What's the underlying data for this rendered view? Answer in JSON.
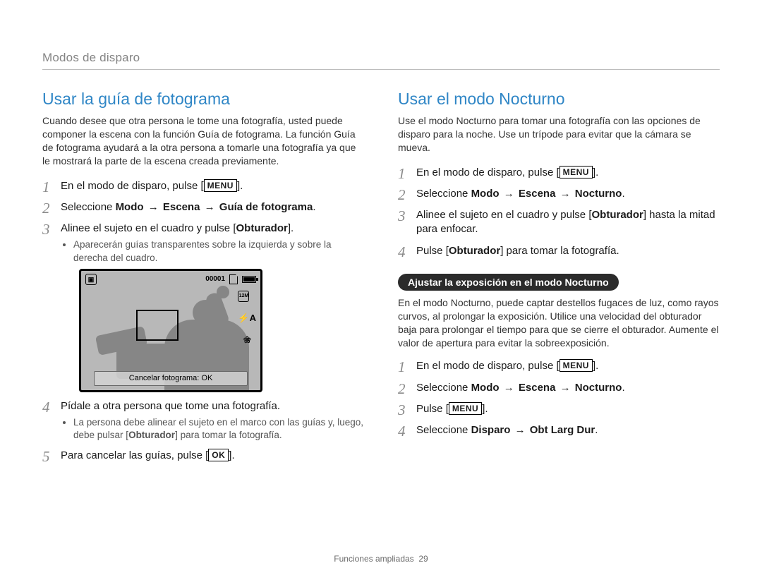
{
  "breadcrumb": "Modos de disparo",
  "footer": {
    "section": "Funciones ampliadas",
    "page": "29"
  },
  "buttons": {
    "menu": "MENU",
    "ok": "OK"
  },
  "left": {
    "title": "Usar la guía de fotograma",
    "intro": "Cuando desee que otra persona le tome una fotografía, usted puede componer la escena con la función Guía de fotograma. La función Guía de fotograma ayudará a la otra persona a tomarle una fotografía ya que le mostrará la parte de la escena creada previamente.",
    "step1_pre": "En el modo de disparo, pulse [",
    "step1_post": "].",
    "step2_pre": "Seleccione ",
    "step2_b1": "Modo",
    "step2_b2": "Escena",
    "step2_b3": "Guía de fotograma",
    "step2_post": ".",
    "step3_pre": "Alinee el sujeto en el cuadro y pulse [",
    "step3_b": "Obturador",
    "step3_post": "].",
    "step3_sub": "Aparecerán guías transparentes sobre la izquierda y sobre la derecha del cuadro.",
    "lcd": {
      "counter": "00001",
      "footer": "Cancelar fotograma: OK",
      "icon_scene": "scene-icon",
      "icon_card": "card-icon",
      "icon_battery": "battery-icon",
      "icon_size": "size-icon",
      "icon_flash": "flash-auto-icon",
      "icon_macro": "macro-icon",
      "flash_label": "⚡A",
      "size_label": "12M",
      "macro_label": "❀"
    },
    "step4": "Pídale a otra persona que tome una fotografía.",
    "step4_sub_pre": "La persona debe alinear el sujeto en el marco con las guías y, luego, debe pulsar [",
    "step4_sub_b": "Obturador",
    "step4_sub_post": "] para tomar la fotografía.",
    "step5_pre": "Para cancelar las guías, pulse [",
    "step5_post": "]."
  },
  "right": {
    "title": "Usar el modo Nocturno",
    "intro": "Use el modo Nocturno para tomar una fotografía con las opciones de disparo para la noche. Use un trípode para evitar que la cámara se mueva.",
    "step1_pre": "En el modo de disparo, pulse [",
    "step1_post": "].",
    "step2_pre": "Seleccione ",
    "step2_b1": "Modo",
    "step2_b2": "Escena",
    "step2_b3": "Nocturno",
    "step2_post": ".",
    "step3_pre": "Alinee el sujeto en el cuadro y pulse [",
    "step3_b": "Obturador",
    "step3_post": "] hasta la mitad para enfocar.",
    "step4_pre": "Pulse [",
    "step4_b": "Obturador",
    "step4_post": "] para tomar la fotografía.",
    "pill": "Ajustar la exposición en el modo Nocturno",
    "sub_intro": "En el modo Nocturno, puede captar destellos fugaces de luz, como rayos curvos, al prolongar la exposición. Utilice una velocidad del obturador baja para prolongar el tiempo para que se cierre el obturador. Aumente el valor de apertura para evitar la sobreexposición.",
    "s2_step1_pre": "En el modo de disparo, pulse [",
    "s2_step1_post": "].",
    "s2_step2_pre": "Seleccione ",
    "s2_step2_b1": "Modo",
    "s2_step2_b2": "Escena",
    "s2_step2_b3": "Nocturno",
    "s2_step2_post": ".",
    "s2_step3_pre": "Pulse [",
    "s2_step3_post": "].",
    "s2_step4_pre": "Seleccione ",
    "s2_step4_b1": "Disparo",
    "s2_step4_b2": "Obt Larg Dur",
    "s2_step4_post": "."
  }
}
